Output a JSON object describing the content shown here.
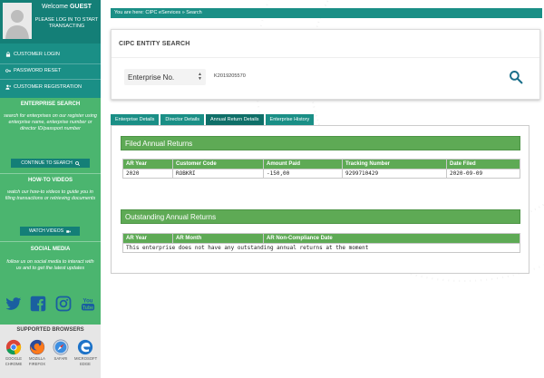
{
  "sidebar": {
    "welcome_label": "Welcome",
    "welcome_user": "GUEST",
    "login_prompt": "PLEASE LOG IN TO START TRANSACTING",
    "nav": [
      {
        "label": "CUSTOMER LOGIN",
        "icon": "lock-icon"
      },
      {
        "label": "PASSWORD RESET",
        "icon": "key-icon"
      },
      {
        "label": "CUSTOMER REGISTRATION",
        "icon": "user-add-icon"
      }
    ],
    "enterprise_search": {
      "title": "ENTERPRISE SEARCH",
      "text": "search for enterprises on our register using enterprise name, enterprise number or director ID/passport number",
      "button": "CONTINUE TO SEARCH"
    },
    "how_to": {
      "title": "HOW-TO VIDEOS",
      "text": "watch our how-to videos to guide you in filing transactions or retrieving documents",
      "button": "WATCH VIDEOS"
    },
    "social": {
      "title": "SOCIAL MEDIA",
      "text": "follow us on social media to interact with us and to get the latest updates",
      "icons": [
        "twitter-icon",
        "facebook-icon",
        "instagram-icon",
        "youtube-icon"
      ]
    },
    "browsers": {
      "title": "SUPPORTED BROWSERS",
      "items": [
        {
          "line1": "GOOGLE",
          "line2": "CHROME"
        },
        {
          "line1": "MOZILLA",
          "line2": "FIREFOX"
        },
        {
          "line1": "SAFARI",
          "line2": ""
        },
        {
          "line1": "MICROSOFT",
          "line2": "EDGE"
        }
      ]
    }
  },
  "breadcrumb": "You are here: CIPC eServices » Search",
  "search": {
    "title": "CIPC ENTITY SEARCH",
    "type_selected": "Enterprise No.",
    "value": "K2019205570"
  },
  "tabs": [
    "Enterprise Details",
    "Director Details",
    "Annual Return Details",
    "Enterprise History"
  ],
  "active_tab": "Annual Return Details",
  "filed": {
    "title": "Filed Annual Returns",
    "headers": [
      "AR Year",
      "Customer Code",
      "Amount Paid",
      "Tracking Number",
      "Date Filed"
    ],
    "rows": [
      [
        "2020",
        "ROBKRI",
        "-150,00",
        "9299710429",
        "2020-09-09"
      ]
    ]
  },
  "outstanding": {
    "title": "Outstanding Annual Returns",
    "headers": [
      "AR Year",
      "AR Month",
      "AR Non-Compliance Date"
    ],
    "message": "This enterprise does not have any outstanding annual returns at the moment"
  },
  "colors": {
    "teal": "#1a8f86",
    "teal_dark": "#147f77",
    "green": "#4bb56f",
    "table_green": "#5eaa55"
  }
}
